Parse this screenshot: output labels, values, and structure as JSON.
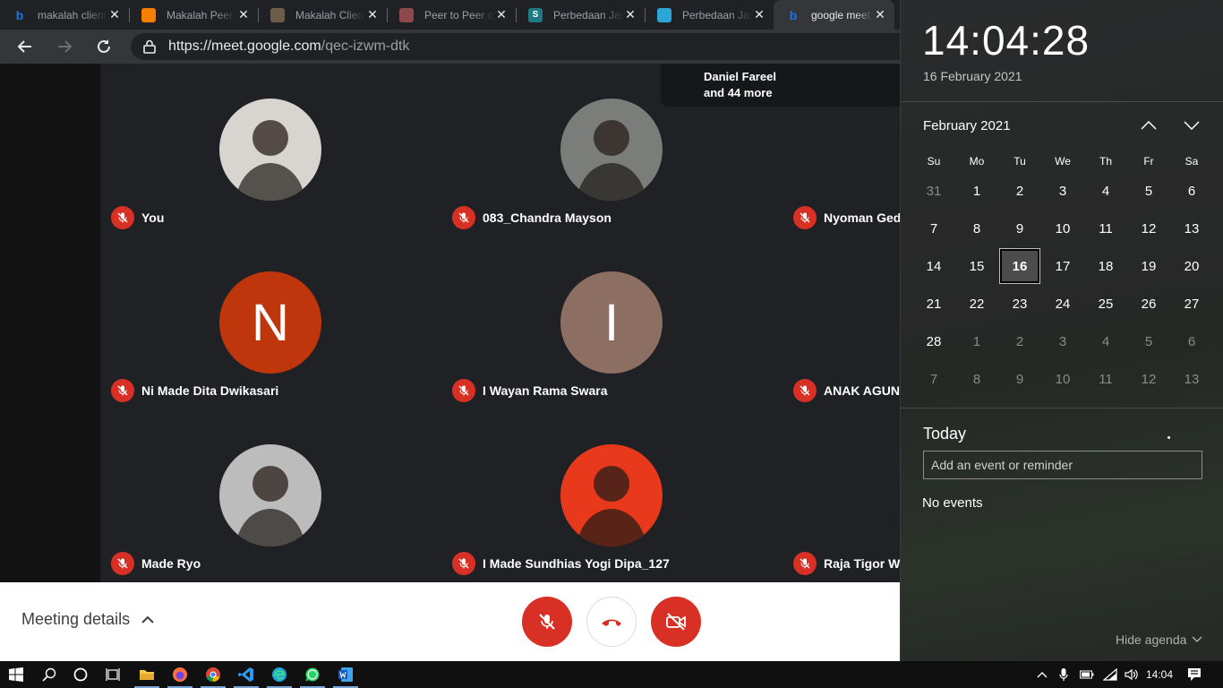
{
  "browser": {
    "tabs": [
      {
        "title": "makalah client",
        "icon": "bing-icon",
        "color": "#1a73e8"
      },
      {
        "title": "Makalah Peer",
        "icon": "blogger-icon",
        "color": "#f57d00"
      },
      {
        "title": "Makalah Client",
        "icon": "site-favicon",
        "color": "#6d5c4a"
      },
      {
        "title": "Peer to Peer d",
        "icon": "site-favicon",
        "color": "#8e4a4a"
      },
      {
        "title": "Perbedaan Jar",
        "icon": "scribd-icon",
        "color": "#1e7b85"
      },
      {
        "title": "Perbedaan Jar",
        "icon": "site-favicon",
        "color": "#2aa7d6"
      },
      {
        "title": "google meet -",
        "icon": "bing-icon",
        "color": "#1a73e8",
        "active": true
      }
    ],
    "url_host": "https://meet.google.com",
    "url_path": "/qec-izwm-dtk"
  },
  "meet": {
    "more_chip": {
      "line1": "Daniel Fareel",
      "line2": "and 44 more"
    },
    "participants": [
      {
        "name": "You",
        "avatar": "photo",
        "bg": "#d8d4d0"
      },
      {
        "name": "083_Chandra Mayson",
        "avatar": "photo",
        "bg": "#7a7d7a"
      },
      {
        "name": "Nyoman Gede",
        "avatar": "hidden"
      },
      {
        "name": "Ni Made Dita Dwikasari",
        "avatar": "letter",
        "letter": "N",
        "bg": "#bf360c"
      },
      {
        "name": "I Wayan Rama Swara",
        "avatar": "letter",
        "letter": "I",
        "bg": "#8d6e63"
      },
      {
        "name": "ANAK AGUNG",
        "avatar": "hidden"
      },
      {
        "name": "Made Ryo",
        "avatar": "photo",
        "bg": "#bcbcbc"
      },
      {
        "name": "I Made Sundhias Yogi Dipa_127",
        "avatar": "photo",
        "bg": "#e8391c"
      },
      {
        "name": "Raja Tigor Wira",
        "avatar": "hidden"
      }
    ],
    "meeting_details_label": "Meeting details",
    "controls": {
      "accent": "#d93025"
    }
  },
  "flyout": {
    "time": "14:04:28",
    "date_long": "16 February 2021",
    "month_label": "February 2021",
    "days_of_week": [
      "Su",
      "Mo",
      "Tu",
      "We",
      "Th",
      "Fr",
      "Sa"
    ],
    "weeks": [
      [
        {
          "d": "31",
          "dim": true
        },
        {
          "d": "1"
        },
        {
          "d": "2"
        },
        {
          "d": "3"
        },
        {
          "d": "4"
        },
        {
          "d": "5"
        },
        {
          "d": "6"
        }
      ],
      [
        {
          "d": "7"
        },
        {
          "d": "8"
        },
        {
          "d": "9"
        },
        {
          "d": "10"
        },
        {
          "d": "11"
        },
        {
          "d": "12"
        },
        {
          "d": "13"
        }
      ],
      [
        {
          "d": "14"
        },
        {
          "d": "15"
        },
        {
          "d": "16",
          "today": true
        },
        {
          "d": "17"
        },
        {
          "d": "18"
        },
        {
          "d": "19"
        },
        {
          "d": "20"
        }
      ],
      [
        {
          "d": "21"
        },
        {
          "d": "22"
        },
        {
          "d": "23"
        },
        {
          "d": "24"
        },
        {
          "d": "25"
        },
        {
          "d": "26"
        },
        {
          "d": "27"
        }
      ],
      [
        {
          "d": "28"
        },
        {
          "d": "1",
          "dim": true
        },
        {
          "d": "2",
          "dim": true
        },
        {
          "d": "3",
          "dim": true
        },
        {
          "d": "4",
          "dim": true
        },
        {
          "d": "5",
          "dim": true
        },
        {
          "d": "6",
          "dim": true
        }
      ],
      [
        {
          "d": "7",
          "dim": true
        },
        {
          "d": "8",
          "dim": true
        },
        {
          "d": "9",
          "dim": true
        },
        {
          "d": "10",
          "dim": true
        },
        {
          "d": "11",
          "dim": true
        },
        {
          "d": "12",
          "dim": true
        },
        {
          "d": "13",
          "dim": true
        }
      ]
    ],
    "today_label": "Today",
    "event_placeholder": "Add an event or reminder",
    "no_events": "No events",
    "hide_agenda": "Hide agenda"
  },
  "taskbar": {
    "apps": [
      "start-icon",
      "search-icon",
      "cortana-icon",
      "task-view-icon",
      "file-explorer-icon",
      "firefox-icon",
      "chrome-icon",
      "vscode-icon",
      "edge-icon",
      "whatsapp-icon",
      "word-icon"
    ],
    "time": "14:04"
  }
}
